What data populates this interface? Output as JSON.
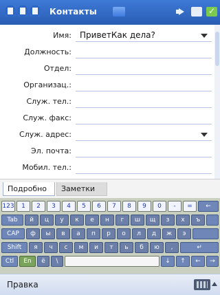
{
  "title_bar": {
    "app_title": "Контакты"
  },
  "form": {
    "fields": [
      {
        "label": "Имя:",
        "value": "ПриветКак дела?",
        "dropdown": true
      },
      {
        "label": "Должность:",
        "value": ""
      },
      {
        "label": "Отдел:",
        "value": ""
      },
      {
        "label": "Организац.:",
        "value": ""
      },
      {
        "label": "Служ. тел.:",
        "value": ""
      },
      {
        "label": "Служ. факс:",
        "value": ""
      },
      {
        "label": "Служ. адрес:",
        "value": "",
        "dropdown": true
      },
      {
        "label": "Эл. почта:",
        "value": ""
      },
      {
        "label": "Мобил. тел.:",
        "value": ""
      }
    ]
  },
  "tabs": [
    {
      "label": "Подробно"
    },
    {
      "label": "Заметки"
    }
  ],
  "keyboard": {
    "row1": [
      "123",
      "1",
      "2",
      "3",
      "4",
      "5",
      "6",
      "7",
      "8",
      "9",
      "0",
      "-",
      "=",
      "←"
    ],
    "row2": [
      "Tab",
      "й",
      "ц",
      "у",
      "к",
      "е",
      "н",
      "г",
      "ш",
      "щ",
      "з",
      "х",
      "ъ"
    ],
    "row3": [
      "CAP",
      "ф",
      "ы",
      "в",
      "а",
      "п",
      "р",
      "о",
      "л",
      "д",
      "ж",
      "э"
    ],
    "row4": [
      "Shift",
      "я",
      "ч",
      "с",
      "м",
      "и",
      "т",
      "ь",
      "б",
      "ю",
      ",",
      "↵"
    ],
    "row5": [
      "Ctl",
      "En",
      "ё",
      "\\",
      "↓",
      "↑",
      "←",
      "→"
    ]
  },
  "bottom_bar": {
    "menu_label": "Правка"
  }
}
